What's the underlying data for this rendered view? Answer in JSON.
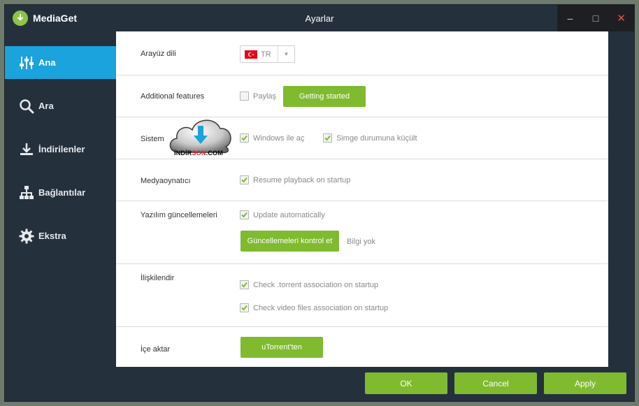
{
  "window": {
    "app_name": "MediaGet",
    "title": "Ayarlar"
  },
  "window_controls": {
    "minimize": "–",
    "maximize": "□",
    "close": "✕"
  },
  "sidebar": {
    "items": [
      {
        "label": "Ana",
        "icon": "sliders-icon",
        "active": true
      },
      {
        "label": "Ara",
        "icon": "search-icon",
        "active": false
      },
      {
        "label": "İndirilenler",
        "icon": "download-icon",
        "active": false
      },
      {
        "label": "Bağlantılar",
        "icon": "network-icon",
        "active": false
      },
      {
        "label": "Ekstra",
        "icon": "gear-icon",
        "active": false
      }
    ]
  },
  "settings": {
    "language": {
      "label": "Arayüz dili",
      "value": "TR",
      "flag": "turkey-flag-icon"
    },
    "additional": {
      "label": "Additional features",
      "share_label": "Paylaş",
      "share_checked": false,
      "button": "Getting started"
    },
    "system": {
      "label": "Sistem",
      "start_windows": "Windows ile aç",
      "start_windows_checked": true,
      "minimize_tray": "Simge durumuna küçült",
      "minimize_tray_checked": true
    },
    "player": {
      "label": "Medyaoynatıcı",
      "resume": "Resume playback on startup",
      "resume_checked": true
    },
    "updates": {
      "label": "Yazılım güncellemeleri",
      "auto": "Update automatically",
      "auto_checked": true,
      "check_button": "Güncellemeleri kontrol et",
      "status": "Bilgi yok"
    },
    "associate": {
      "label": "İlişkilendir",
      "torrent": "Check .torrent association on startup",
      "torrent_checked": true,
      "video": "Check video files association on startup",
      "video_checked": true
    },
    "import": {
      "label": "İçe aktar",
      "button": "uTorrent'ten"
    }
  },
  "watermark": {
    "text_main": "İNDİR",
    "text_accent": "SON",
    "text_suffix": ".COM"
  },
  "footer": {
    "ok": "OK",
    "cancel": "Cancel",
    "apply": "Apply"
  },
  "colors": {
    "accent_green": "#7fba2f",
    "active_blue": "#1aa3dd",
    "dark_bg": "#25303d"
  }
}
